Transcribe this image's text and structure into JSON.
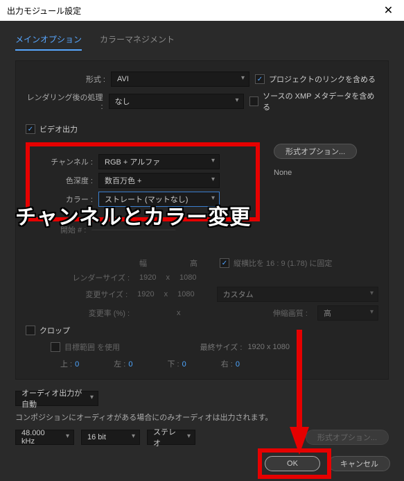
{
  "window": {
    "title": "出力モジュール設定"
  },
  "tabs": {
    "main": "メインオプション",
    "color": "カラーマネジメント"
  },
  "format": {
    "label": "形式 :",
    "value": "AVI",
    "include_link": "プロジェクトのリンクを含める",
    "post_label": "レンダリング後の処理 :",
    "post_value": "なし",
    "include_xmp": "ソースの XMP メタデータを含める"
  },
  "video": {
    "output_label": "ビデオ出力",
    "channel_label": "チャンネル :",
    "channel_value": "RGB + アルファ",
    "depth_label": "色深度 :",
    "depth_value": "数百万色 +",
    "color_label": "カラー :",
    "color_value": "ストレート (マットなし)",
    "format_options_btn": "形式オプション...",
    "none": "None",
    "start_label": "開始 # :",
    "lock_aspect": "縦横比を 16 : 9 (1.78) に固定",
    "render_size_label": "レンダーサイズ :",
    "render_w": "1920",
    "render_h": "1080",
    "change_size_label": "変更サイズ :",
    "change_w": "1920",
    "change_h": "1080",
    "custom": "カスタム",
    "change_rate_label": "変更率 (%) :",
    "stretch_q": "伸縮画質 :",
    "stretch_v": "高",
    "x": "x",
    "width_label": "幅",
    "height_label": "高"
  },
  "crop": {
    "label": "クロップ",
    "use_target": "目標範囲 を使用",
    "final_size_label": "最終サイズ :",
    "final_size": "1920 x 1080",
    "top": "上 :",
    "left": "左 :",
    "bottom": "下 :",
    "right": "右 :",
    "zero": "0"
  },
  "audio": {
    "auto_label": "オーディオ出力が自動",
    "note": "コンポジションにオーディオがある場合にのみオーディオは出力されます。",
    "rate": "48.000 kHz",
    "bit": "16 bit",
    "ch": "ステレオ",
    "format_options_btn": "形式オプション..."
  },
  "buttons": {
    "ok": "OK",
    "cancel": "キャンセル"
  },
  "overlay": "チャンネルとカラー変更"
}
